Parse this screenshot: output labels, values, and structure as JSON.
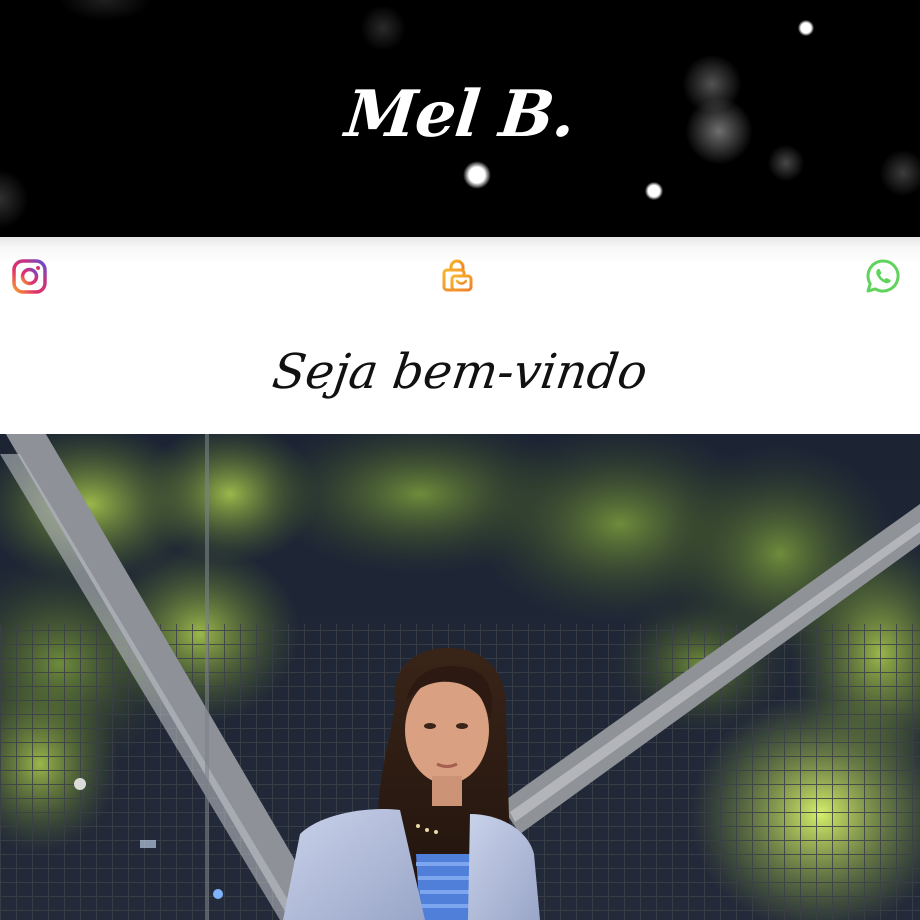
{
  "header": {
    "brand": "Mel B.",
    "background": "#000000"
  },
  "social": {
    "instagram": {
      "icon": "instagram-icon",
      "color": "#c13584"
    },
    "shop": {
      "icon": "shopping-bag-icon",
      "color": "#f5a623"
    },
    "whatsapp": {
      "icon": "whatsapp-icon",
      "color": "#4cd964"
    }
  },
  "welcome": {
    "text": "Seja bem-vindo"
  },
  "photo": {
    "subject": "portrait-photo"
  }
}
